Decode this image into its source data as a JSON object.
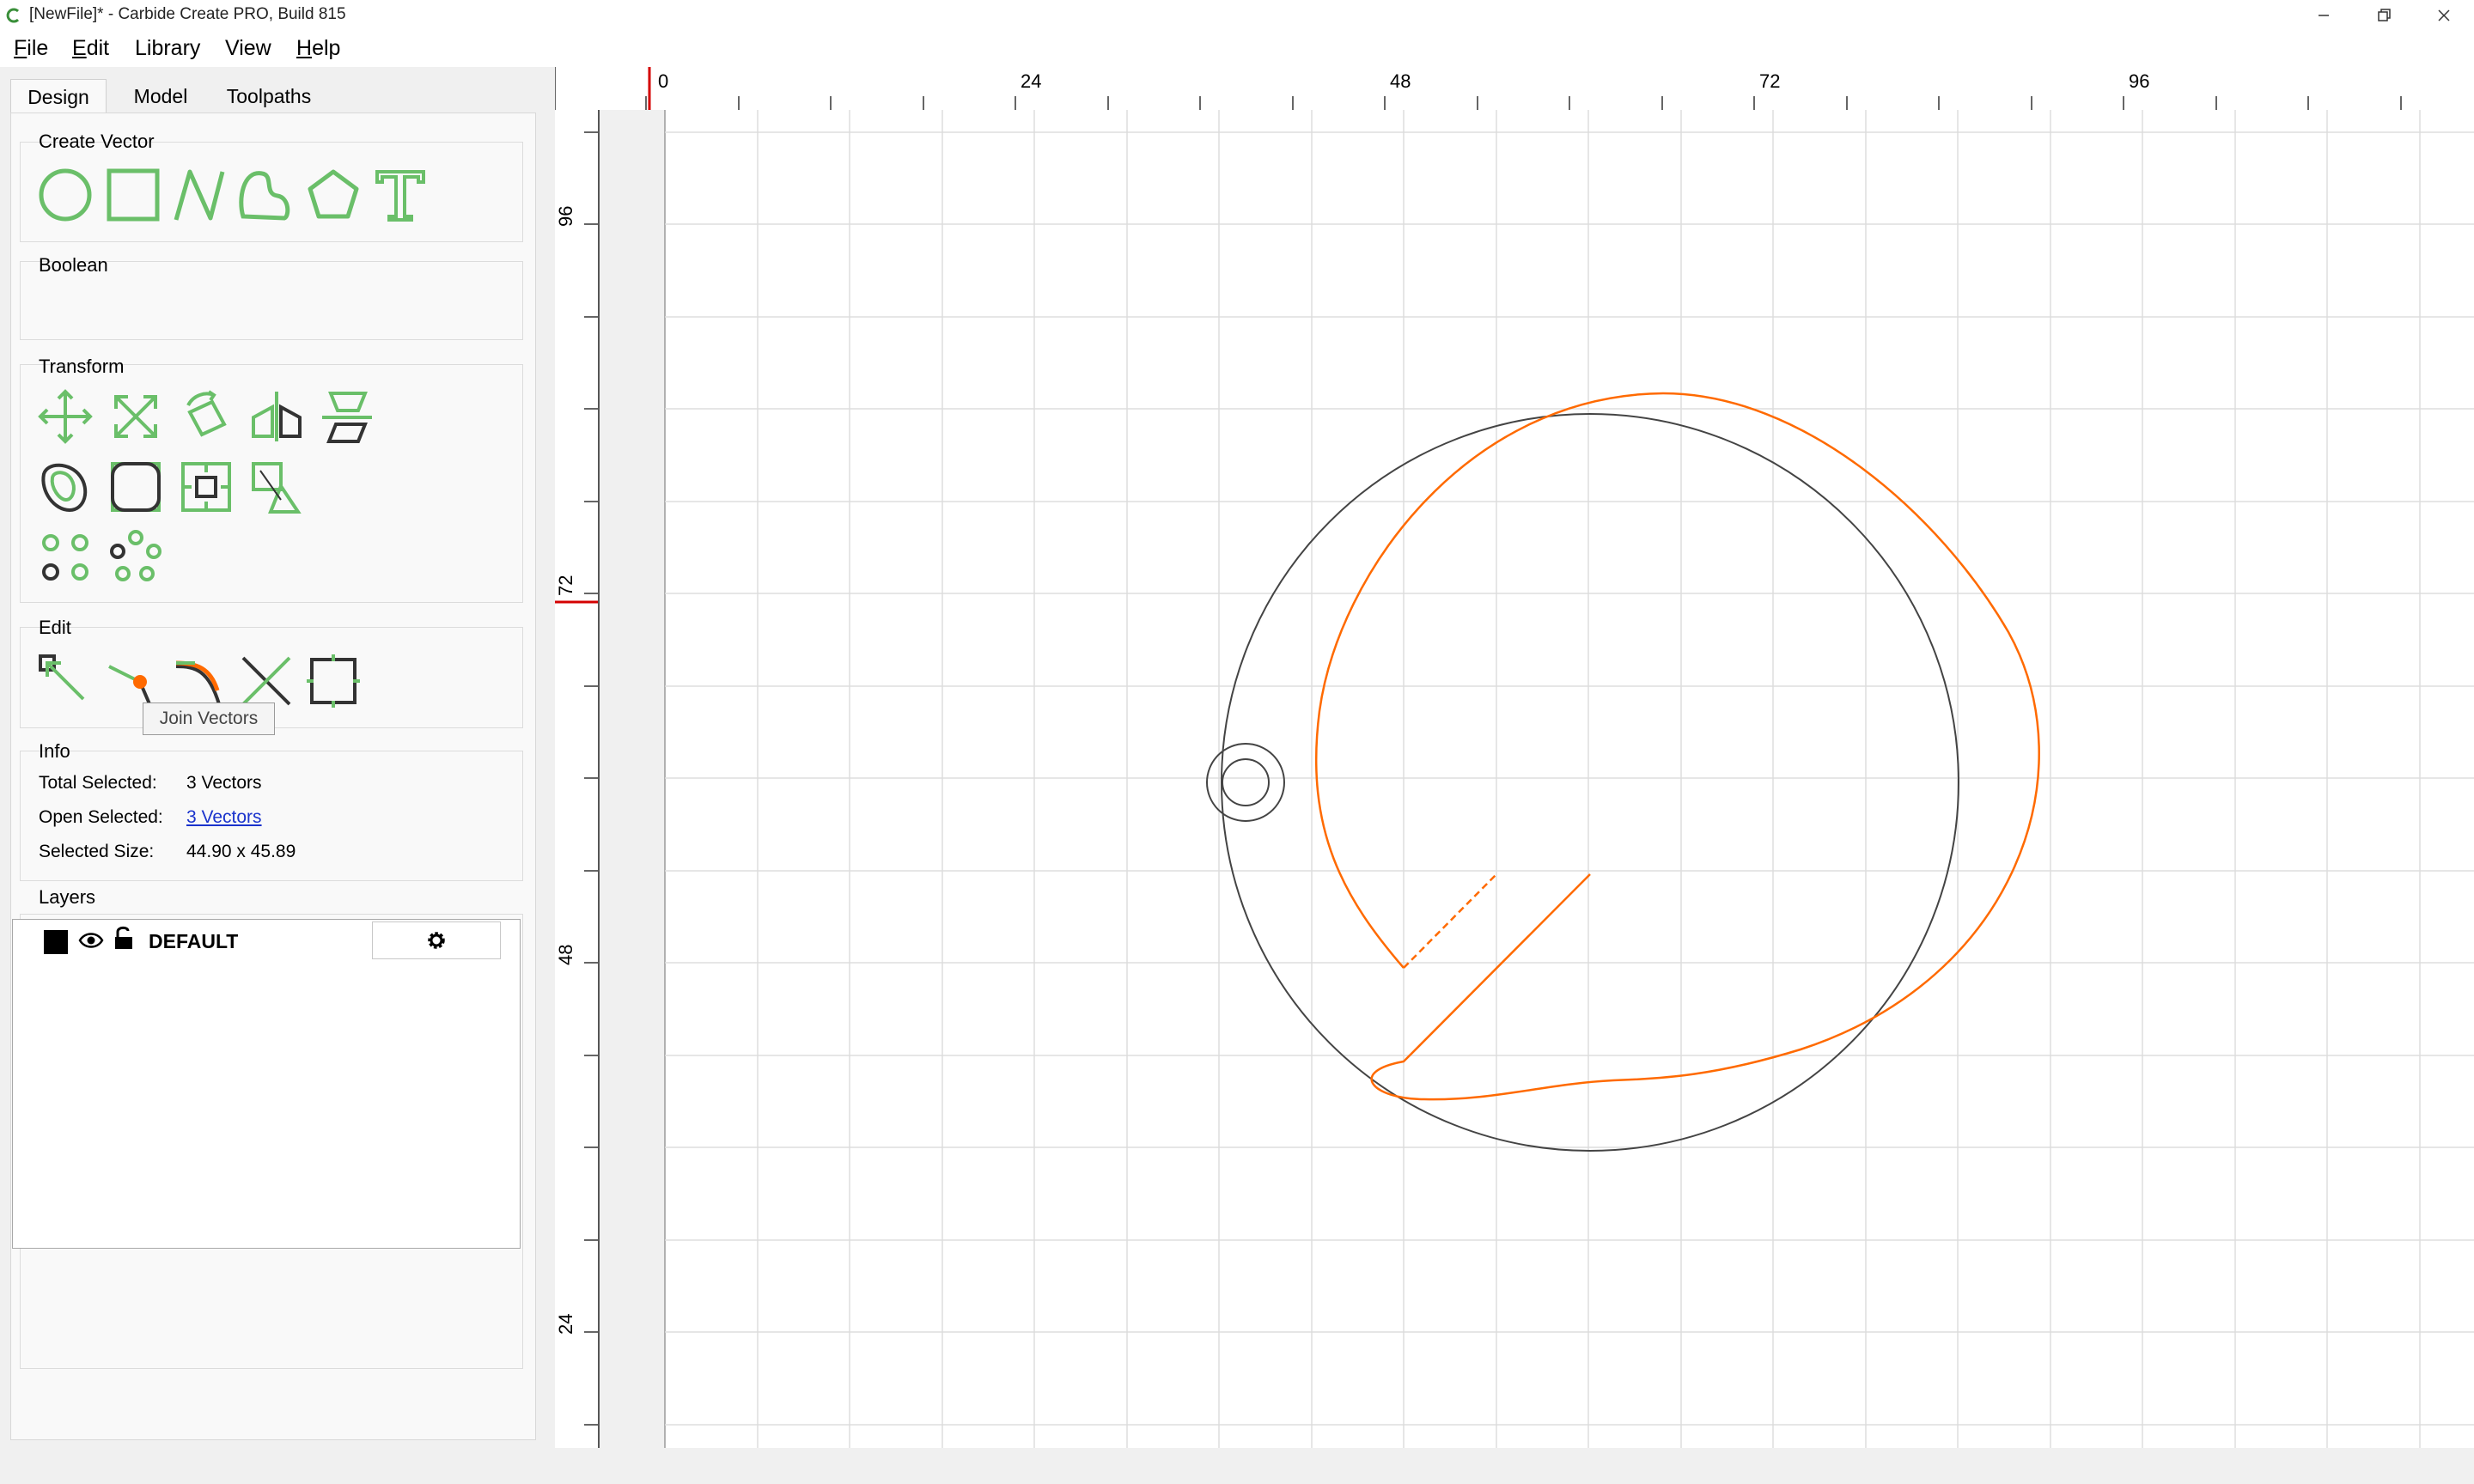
{
  "window": {
    "title": "[NewFile]* - Carbide Create PRO, Build 815"
  },
  "menu": {
    "items": [
      {
        "label": "File",
        "ul": "F",
        "rest": "ile"
      },
      {
        "label": "Edit",
        "ul": "E",
        "rest": "dit"
      },
      {
        "label": "Library",
        "ul": "",
        "rest": "Library"
      },
      {
        "label": "View",
        "ul": "",
        "rest": "View"
      },
      {
        "label": "Help",
        "ul": "H",
        "rest": "elp"
      }
    ]
  },
  "tabs": [
    "Design",
    "Model",
    "Toolpaths"
  ],
  "groups": {
    "create_vector": "Create Vector",
    "boolean": "Boolean",
    "transform": "Transform",
    "edit": "Edit",
    "info": "Info",
    "layers": "Layers"
  },
  "tooltip": "Join Vectors",
  "info": {
    "total_selected_label": "Total Selected:",
    "total_selected_value": "3 Vectors",
    "open_selected_label": "Open Selected:",
    "open_selected_value": "3 Vectors",
    "selected_size_label": "Selected Size:",
    "selected_size_value": "44.90 x 45.89"
  },
  "layers": [
    {
      "name": "DEFAULT",
      "color": "#000000"
    }
  ],
  "ruler": {
    "top_labels": [
      "0",
      "24",
      "48",
      "72",
      "96"
    ],
    "left_labels": [
      "96",
      "72",
      "48",
      "24"
    ]
  },
  "colors": {
    "accent_green": "#6abf69",
    "vector_orange": "#ff6a00",
    "grid": "#dddddd"
  }
}
